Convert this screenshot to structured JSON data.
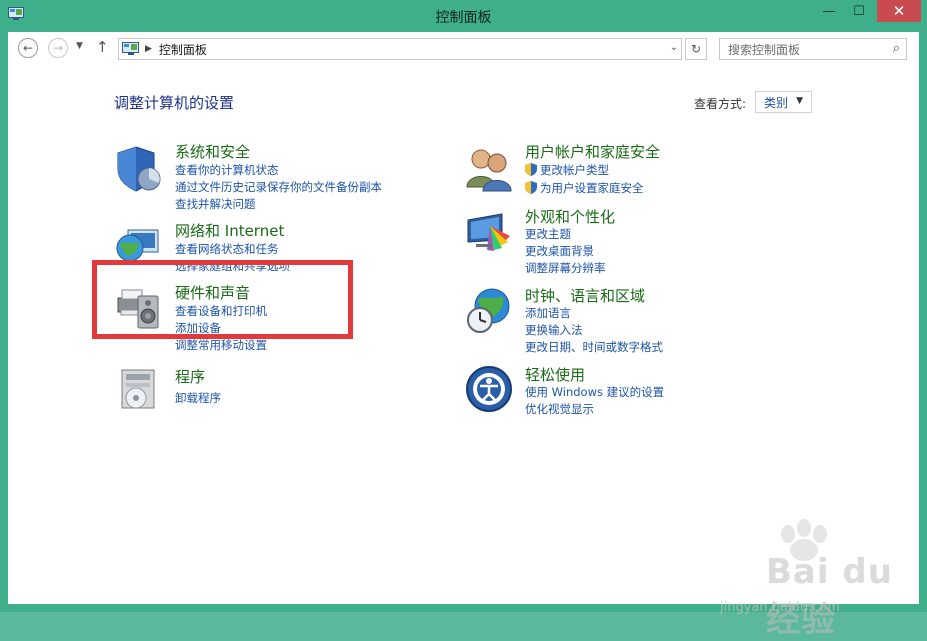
{
  "window": {
    "title": "控制面板"
  },
  "address": {
    "path": "控制面板"
  },
  "search": {
    "placeholder": "搜索控制面板"
  },
  "page": {
    "title": "调整计算机的设置",
    "view_label": "查看方式:",
    "view_value": "类别"
  },
  "categories": [
    {
      "title": "系统和安全",
      "icon": "shield-pie-icon",
      "links": [
        "查看你的计算机状态",
        "通过文件历史记录保存你的文件备份副本",
        "查找并解决问题"
      ]
    },
    {
      "title": "网络和 Internet",
      "icon": "globe-network-icon",
      "links": [
        "查看网络状态和任务",
        "选择家庭组和共享选项"
      ]
    },
    {
      "title": "硬件和声音",
      "icon": "printer-speaker-icon",
      "links": [
        "查看设备和打印机",
        "添加设备",
        "调整常用移动设置"
      ]
    },
    {
      "title": "程序",
      "icon": "program-disc-icon",
      "links": [
        "卸载程序"
      ]
    },
    {
      "title": "用户帐户和家庭安全",
      "icon": "users-icon",
      "links": [
        "更改帐户类型",
        "为用户设置家庭安全"
      ]
    },
    {
      "title": "外观和个性化",
      "icon": "monitor-colors-icon",
      "links": [
        "更改主题",
        "更改桌面背景",
        "调整屏幕分辨率"
      ]
    },
    {
      "title": "时钟、语言和区域",
      "icon": "globe-clock-icon",
      "links": [
        "添加语言",
        "更换输入法",
        "更改日期、时间或数字格式"
      ]
    },
    {
      "title": "轻松使用",
      "icon": "ease-of-access-icon",
      "links": [
        "使用 Windows 建议的设置",
        "优化视觉显示"
      ]
    }
  ],
  "watermark": {
    "text": "Bai du 经验",
    "sub": "jingyan.baidu.com"
  },
  "colors": {
    "frame": "#3fae8a",
    "close": "#c74b50",
    "link": "#1d54a8",
    "category_title": "#1a6a16",
    "page_title": "#1e3287",
    "highlight": "#e23a3a"
  }
}
